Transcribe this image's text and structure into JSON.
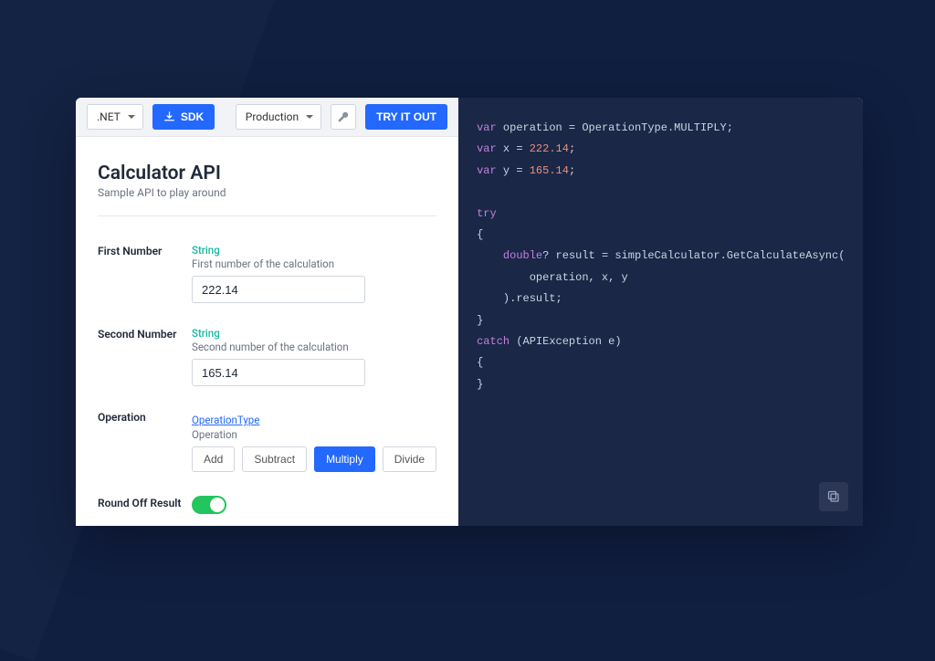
{
  "toolbar": {
    "lang": ".NET",
    "sdk": "SDK",
    "env": "Production",
    "try": "TRY IT OUT"
  },
  "header": {
    "title": "Calculator API",
    "subtitle": "Sample API to play around"
  },
  "fields": {
    "first": {
      "label": "First Number",
      "type": "String",
      "desc": "First number of the calculation",
      "value": "222.14"
    },
    "second": {
      "label": "Second Number",
      "type": "String",
      "desc": "Second number of the calculation",
      "value": "165.14"
    },
    "operation": {
      "label": "Operation",
      "typeLink": "OperationType",
      "desc": "Operation",
      "options": [
        "Add",
        "Subtract",
        "Multiply",
        "Divide"
      ],
      "selected": "Multiply"
    },
    "round": {
      "label": "Round Off Result"
    }
  },
  "code": {
    "l1a": "var",
    "l1b": " operation = OperationType.MULTIPLY;",
    "l2a": "var",
    "l2b": " x = ",
    "l2c": "222.14",
    "l2d": ";",
    "l3a": "var",
    "l3b": " y = ",
    "l3c": "165.14",
    "l3d": ";",
    "l5": "try",
    "l6": "{",
    "l7a": "    ",
    "l7b": "double",
    "l7c": "? result = simpleCalculator.GetCalculateAsync(",
    "l8": "        operation, x, y",
    "l9": "    ).result;",
    "l10": "}",
    "l11a": "catch",
    "l11b": " (APIException e)",
    "l12": "{",
    "l13": "}"
  }
}
